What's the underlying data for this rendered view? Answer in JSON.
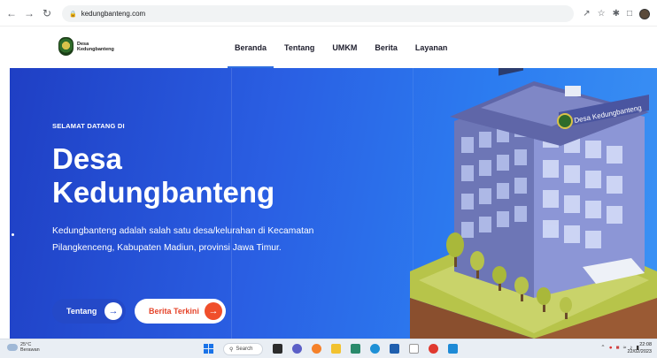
{
  "browser": {
    "url": "kedungbanteng.com"
  },
  "site": {
    "logo_line1": "Desa",
    "logo_line2": "Kedungbanteng",
    "nav": [
      "Beranda",
      "Tentang",
      "UMKM",
      "Berita",
      "Layanan"
    ],
    "active_nav": "Beranda"
  },
  "hero": {
    "eyebrow": "SELAMAT DATANG DI",
    "title_line1": "Desa",
    "title_line2": "Kedungbanteng",
    "description": "Kedungbanteng adalah salah satu desa/kelurahan di Kecamatan Pilangkenceng, Kabupaten Madiun, provinsi Jawa Timur.",
    "primary_button": "Tentang",
    "secondary_button": "Berita Terkini",
    "building_sign": "Desa Kedungbanteng"
  },
  "taskbar": {
    "temperature": "25°C",
    "weather": "Berawan",
    "search": "Search",
    "time": "22:08",
    "date": "22/02/2023"
  },
  "colors": {
    "hero_start": "#1f3fc4",
    "hero_end": "#3b92f4",
    "accent_orange": "#f04f2b",
    "nav_active": "#2f6fe0"
  }
}
